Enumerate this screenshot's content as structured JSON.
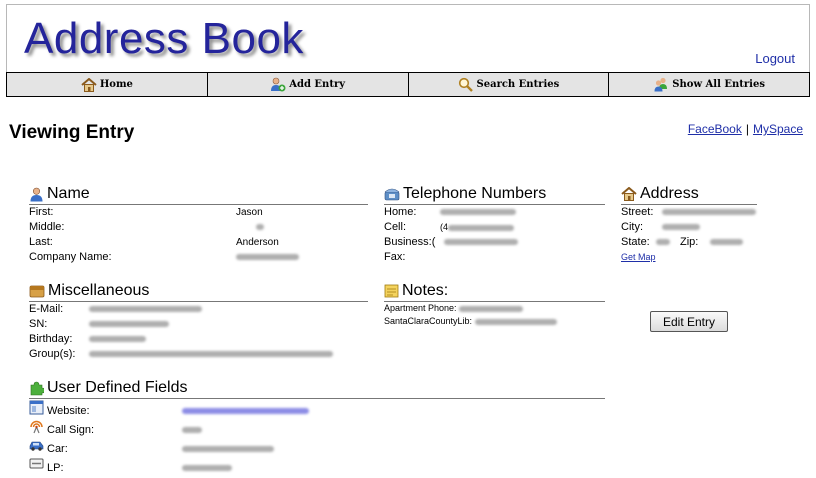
{
  "header": {
    "title": "Address Book",
    "logout_label": "Logout"
  },
  "nav": {
    "home": "Home",
    "add": "Add Entry",
    "search": "Search Entries",
    "show_all": "Show All Entries"
  },
  "page": {
    "title": "Viewing Entry"
  },
  "social": {
    "facebook": "FaceBook",
    "separator": "|",
    "myspace": "MySpace"
  },
  "name_section": {
    "heading": "Name",
    "first_label": "First:",
    "first_value": "Jason",
    "middle_label": "Middle:",
    "last_label": "Last:",
    "last_value": "Anderson",
    "company_label": "Company Name:"
  },
  "phone_section": {
    "heading": "Telephone Numbers",
    "home_label": "Home:",
    "cell_label": "Cell:",
    "cell_prefix": "(4",
    "business_label": "Business:(",
    "fax_label": "Fax:"
  },
  "address_section": {
    "heading": "Address",
    "street_label": "Street:",
    "city_label": "City:",
    "state_label": "State:",
    "zip_label": "Zip:",
    "map_link": "Get Map"
  },
  "misc_section": {
    "heading": "Miscellaneous",
    "email_label": "E-Mail:",
    "sn_label": "SN:",
    "birthday_label": "Birthday:",
    "groups_label": "Group(s):"
  },
  "notes_section": {
    "heading": "Notes:",
    "apartment_label": "Apartment Phone:",
    "library_label": "SantaClaraCountyLib:"
  },
  "edit_button": "Edit Entry",
  "udf_section": {
    "heading": "User Defined Fields",
    "website_label": "Website:",
    "callsign_label": "Call Sign:",
    "car_label": "Car:",
    "lp_label": "LP:"
  }
}
